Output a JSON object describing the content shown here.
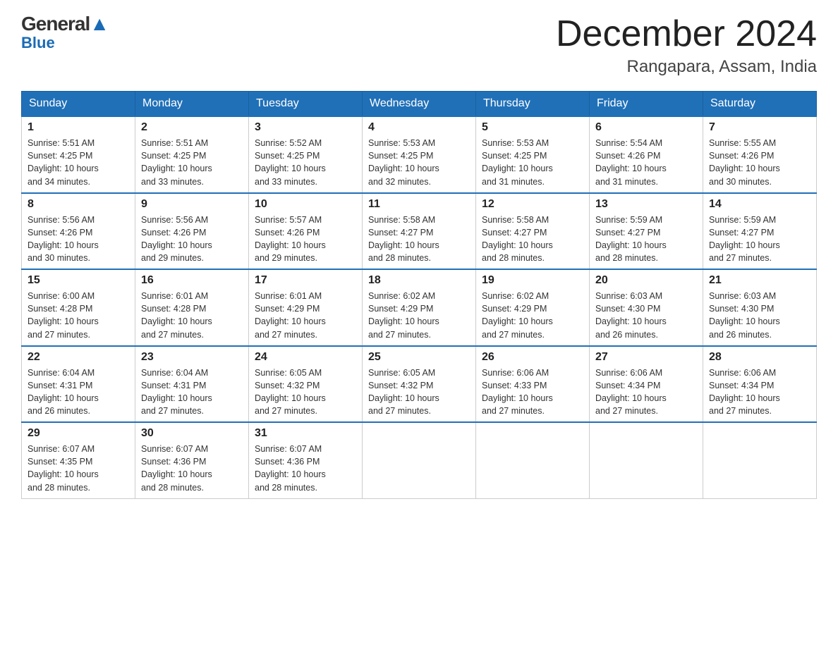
{
  "header": {
    "logo_general": "General",
    "logo_blue": "Blue",
    "title": "December 2024",
    "subtitle": "Rangapara, Assam, India"
  },
  "days_of_week": [
    "Sunday",
    "Monday",
    "Tuesday",
    "Wednesday",
    "Thursday",
    "Friday",
    "Saturday"
  ],
  "weeks": [
    [
      {
        "day": "1",
        "sunrise": "5:51 AM",
        "sunset": "4:25 PM",
        "daylight": "10 hours and 34 minutes."
      },
      {
        "day": "2",
        "sunrise": "5:51 AM",
        "sunset": "4:25 PM",
        "daylight": "10 hours and 33 minutes."
      },
      {
        "day": "3",
        "sunrise": "5:52 AM",
        "sunset": "4:25 PM",
        "daylight": "10 hours and 33 minutes."
      },
      {
        "day": "4",
        "sunrise": "5:53 AM",
        "sunset": "4:25 PM",
        "daylight": "10 hours and 32 minutes."
      },
      {
        "day": "5",
        "sunrise": "5:53 AM",
        "sunset": "4:25 PM",
        "daylight": "10 hours and 31 minutes."
      },
      {
        "day": "6",
        "sunrise": "5:54 AM",
        "sunset": "4:26 PM",
        "daylight": "10 hours and 31 minutes."
      },
      {
        "day": "7",
        "sunrise": "5:55 AM",
        "sunset": "4:26 PM",
        "daylight": "10 hours and 30 minutes."
      }
    ],
    [
      {
        "day": "8",
        "sunrise": "5:56 AM",
        "sunset": "4:26 PM",
        "daylight": "10 hours and 30 minutes."
      },
      {
        "day": "9",
        "sunrise": "5:56 AM",
        "sunset": "4:26 PM",
        "daylight": "10 hours and 29 minutes."
      },
      {
        "day": "10",
        "sunrise": "5:57 AM",
        "sunset": "4:26 PM",
        "daylight": "10 hours and 29 minutes."
      },
      {
        "day": "11",
        "sunrise": "5:58 AM",
        "sunset": "4:27 PM",
        "daylight": "10 hours and 28 minutes."
      },
      {
        "day": "12",
        "sunrise": "5:58 AM",
        "sunset": "4:27 PM",
        "daylight": "10 hours and 28 minutes."
      },
      {
        "day": "13",
        "sunrise": "5:59 AM",
        "sunset": "4:27 PM",
        "daylight": "10 hours and 28 minutes."
      },
      {
        "day": "14",
        "sunrise": "5:59 AM",
        "sunset": "4:27 PM",
        "daylight": "10 hours and 27 minutes."
      }
    ],
    [
      {
        "day": "15",
        "sunrise": "6:00 AM",
        "sunset": "4:28 PM",
        "daylight": "10 hours and 27 minutes."
      },
      {
        "day": "16",
        "sunrise": "6:01 AM",
        "sunset": "4:28 PM",
        "daylight": "10 hours and 27 minutes."
      },
      {
        "day": "17",
        "sunrise": "6:01 AM",
        "sunset": "4:29 PM",
        "daylight": "10 hours and 27 minutes."
      },
      {
        "day": "18",
        "sunrise": "6:02 AM",
        "sunset": "4:29 PM",
        "daylight": "10 hours and 27 minutes."
      },
      {
        "day": "19",
        "sunrise": "6:02 AM",
        "sunset": "4:29 PM",
        "daylight": "10 hours and 27 minutes."
      },
      {
        "day": "20",
        "sunrise": "6:03 AM",
        "sunset": "4:30 PM",
        "daylight": "10 hours and 26 minutes."
      },
      {
        "day": "21",
        "sunrise": "6:03 AM",
        "sunset": "4:30 PM",
        "daylight": "10 hours and 26 minutes."
      }
    ],
    [
      {
        "day": "22",
        "sunrise": "6:04 AM",
        "sunset": "4:31 PM",
        "daylight": "10 hours and 26 minutes."
      },
      {
        "day": "23",
        "sunrise": "6:04 AM",
        "sunset": "4:31 PM",
        "daylight": "10 hours and 27 minutes."
      },
      {
        "day": "24",
        "sunrise": "6:05 AM",
        "sunset": "4:32 PM",
        "daylight": "10 hours and 27 minutes."
      },
      {
        "day": "25",
        "sunrise": "6:05 AM",
        "sunset": "4:32 PM",
        "daylight": "10 hours and 27 minutes."
      },
      {
        "day": "26",
        "sunrise": "6:06 AM",
        "sunset": "4:33 PM",
        "daylight": "10 hours and 27 minutes."
      },
      {
        "day": "27",
        "sunrise": "6:06 AM",
        "sunset": "4:34 PM",
        "daylight": "10 hours and 27 minutes."
      },
      {
        "day": "28",
        "sunrise": "6:06 AM",
        "sunset": "4:34 PM",
        "daylight": "10 hours and 27 minutes."
      }
    ],
    [
      {
        "day": "29",
        "sunrise": "6:07 AM",
        "sunset": "4:35 PM",
        "daylight": "10 hours and 28 minutes."
      },
      {
        "day": "30",
        "sunrise": "6:07 AM",
        "sunset": "4:36 PM",
        "daylight": "10 hours and 28 minutes."
      },
      {
        "day": "31",
        "sunrise": "6:07 AM",
        "sunset": "4:36 PM",
        "daylight": "10 hours and 28 minutes."
      },
      null,
      null,
      null,
      null
    ]
  ],
  "labels": {
    "sunrise": "Sunrise:",
    "sunset": "Sunset:",
    "daylight": "Daylight:"
  }
}
